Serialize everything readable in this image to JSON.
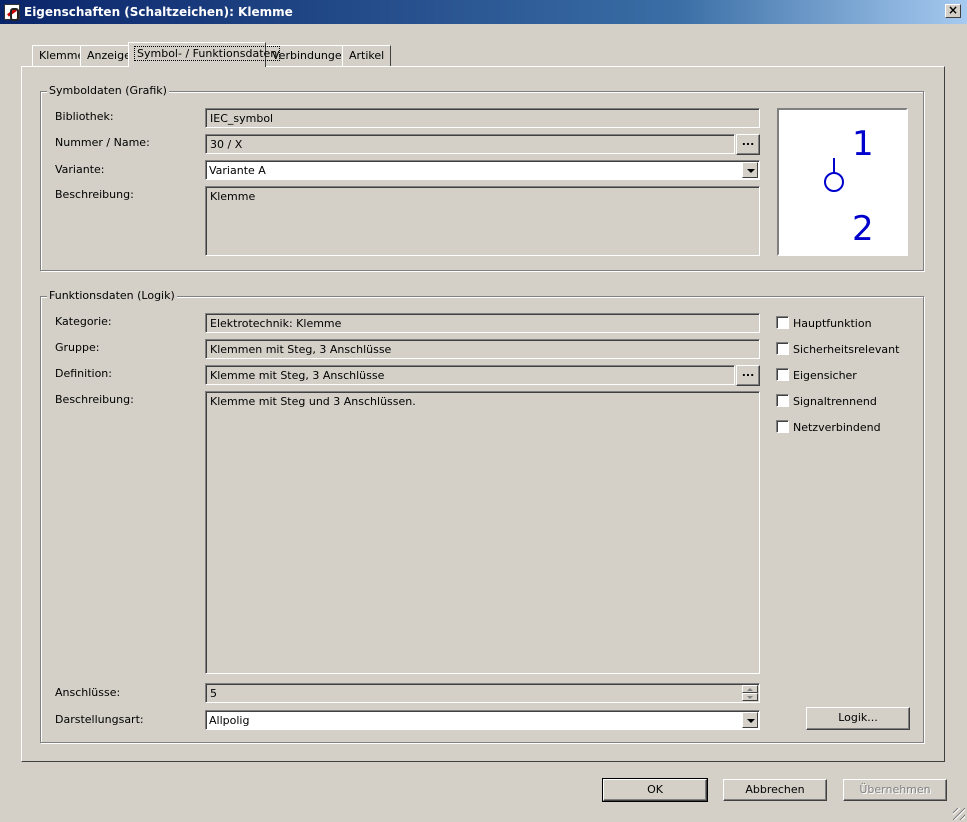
{
  "window": {
    "title": "Eigenschaften (Schaltzeichen): Klemme",
    "close_glyph": "×"
  },
  "tabs": [
    {
      "label": "Klemme"
    },
    {
      "label": "Anzeige"
    },
    {
      "label": "Symbol- / Funktionsdaten"
    },
    {
      "label": "Verbindungen"
    },
    {
      "label": "Artikel"
    }
  ],
  "symbol_group": {
    "legend": "Symboldaten (Grafik)",
    "bibliothek_label": "Bibliothek:",
    "bibliothek_value": "IEC_symbol",
    "nummer_label": "Nummer / Name:",
    "nummer_value": "30 / X",
    "variante_label": "Variante:",
    "variante_value": "Variante A",
    "beschreibung_label": "Beschreibung:",
    "beschreibung_value": "Klemme",
    "browse_label": "...",
    "preview_top": "1",
    "preview_bottom": "2"
  },
  "function_group": {
    "legend": "Funktionsdaten (Logik)",
    "kategorie_label": "Kategorie:",
    "kategorie_value": "Elektrotechnik: Klemme",
    "gruppe_label": "Gruppe:",
    "gruppe_value": "Klemmen mit Steg, 3 Anschlüsse",
    "definition_label": "Definition:",
    "definition_value": "Klemme mit Steg, 3 Anschlüsse",
    "browse_label": "...",
    "beschreibung_label": "Beschreibung:",
    "beschreibung_value": "Klemme mit Steg und 3 Anschlüssen.",
    "anschluesse_label": "Anschlüsse:",
    "anschluesse_value": "5",
    "darstellungsart_label": "Darstellungsart:",
    "darstellungsart_value": "Allpolig",
    "checkboxes": [
      {
        "label": "Hauptfunktion",
        "checked": false
      },
      {
        "label": "Sicherheitsrelevant",
        "checked": false
      },
      {
        "label": "Eigensicher",
        "checked": false
      },
      {
        "label": "Signaltrennend",
        "checked": false
      },
      {
        "label": "Netzverbindend",
        "checked": false
      }
    ],
    "logik_button": "Logik..."
  },
  "footer": {
    "ok": "OK",
    "cancel": "Abbrechen",
    "apply": "Übernehmen"
  },
  "colors": {
    "dialog_bg": "#d4d0c8",
    "titlebar": "#0a246a",
    "symbol_blue": "#0000cc"
  }
}
